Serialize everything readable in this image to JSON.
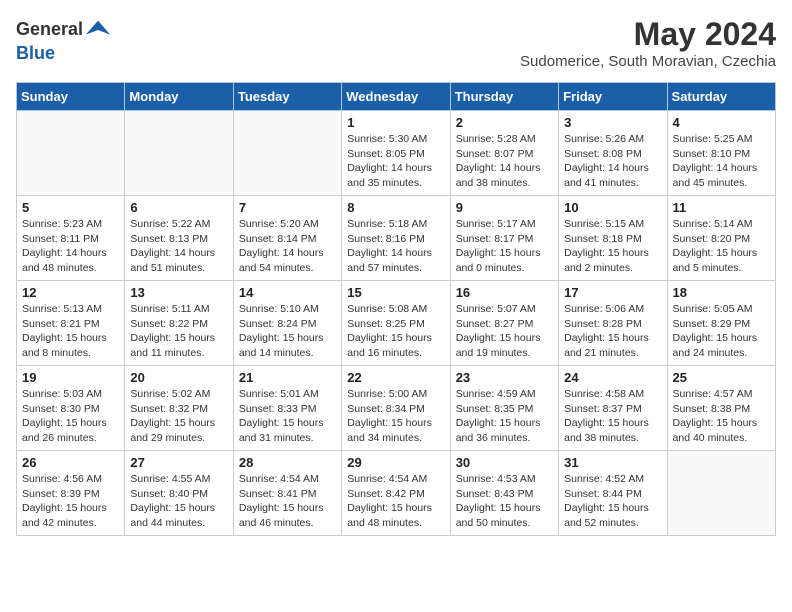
{
  "header": {
    "logo_line1": "General",
    "logo_line2": "Blue",
    "month_year": "May 2024",
    "location": "Sudomerice, South Moravian, Czechia"
  },
  "weekdays": [
    "Sunday",
    "Monday",
    "Tuesday",
    "Wednesday",
    "Thursday",
    "Friday",
    "Saturday"
  ],
  "weeks": [
    [
      {
        "day": "",
        "info": ""
      },
      {
        "day": "",
        "info": ""
      },
      {
        "day": "",
        "info": ""
      },
      {
        "day": "1",
        "info": "Sunrise: 5:30 AM\nSunset: 8:05 PM\nDaylight: 14 hours and 35 minutes."
      },
      {
        "day": "2",
        "info": "Sunrise: 5:28 AM\nSunset: 8:07 PM\nDaylight: 14 hours and 38 minutes."
      },
      {
        "day": "3",
        "info": "Sunrise: 5:26 AM\nSunset: 8:08 PM\nDaylight: 14 hours and 41 minutes."
      },
      {
        "day": "4",
        "info": "Sunrise: 5:25 AM\nSunset: 8:10 PM\nDaylight: 14 hours and 45 minutes."
      }
    ],
    [
      {
        "day": "5",
        "info": "Sunrise: 5:23 AM\nSunset: 8:11 PM\nDaylight: 14 hours and 48 minutes."
      },
      {
        "day": "6",
        "info": "Sunrise: 5:22 AM\nSunset: 8:13 PM\nDaylight: 14 hours and 51 minutes."
      },
      {
        "day": "7",
        "info": "Sunrise: 5:20 AM\nSunset: 8:14 PM\nDaylight: 14 hours and 54 minutes."
      },
      {
        "day": "8",
        "info": "Sunrise: 5:18 AM\nSunset: 8:16 PM\nDaylight: 14 hours and 57 minutes."
      },
      {
        "day": "9",
        "info": "Sunrise: 5:17 AM\nSunset: 8:17 PM\nDaylight: 15 hours and 0 minutes."
      },
      {
        "day": "10",
        "info": "Sunrise: 5:15 AM\nSunset: 8:18 PM\nDaylight: 15 hours and 2 minutes."
      },
      {
        "day": "11",
        "info": "Sunrise: 5:14 AM\nSunset: 8:20 PM\nDaylight: 15 hours and 5 minutes."
      }
    ],
    [
      {
        "day": "12",
        "info": "Sunrise: 5:13 AM\nSunset: 8:21 PM\nDaylight: 15 hours and 8 minutes."
      },
      {
        "day": "13",
        "info": "Sunrise: 5:11 AM\nSunset: 8:22 PM\nDaylight: 15 hours and 11 minutes."
      },
      {
        "day": "14",
        "info": "Sunrise: 5:10 AM\nSunset: 8:24 PM\nDaylight: 15 hours and 14 minutes."
      },
      {
        "day": "15",
        "info": "Sunrise: 5:08 AM\nSunset: 8:25 PM\nDaylight: 15 hours and 16 minutes."
      },
      {
        "day": "16",
        "info": "Sunrise: 5:07 AM\nSunset: 8:27 PM\nDaylight: 15 hours and 19 minutes."
      },
      {
        "day": "17",
        "info": "Sunrise: 5:06 AM\nSunset: 8:28 PM\nDaylight: 15 hours and 21 minutes."
      },
      {
        "day": "18",
        "info": "Sunrise: 5:05 AM\nSunset: 8:29 PM\nDaylight: 15 hours and 24 minutes."
      }
    ],
    [
      {
        "day": "19",
        "info": "Sunrise: 5:03 AM\nSunset: 8:30 PM\nDaylight: 15 hours and 26 minutes."
      },
      {
        "day": "20",
        "info": "Sunrise: 5:02 AM\nSunset: 8:32 PM\nDaylight: 15 hours and 29 minutes."
      },
      {
        "day": "21",
        "info": "Sunrise: 5:01 AM\nSunset: 8:33 PM\nDaylight: 15 hours and 31 minutes."
      },
      {
        "day": "22",
        "info": "Sunrise: 5:00 AM\nSunset: 8:34 PM\nDaylight: 15 hours and 34 minutes."
      },
      {
        "day": "23",
        "info": "Sunrise: 4:59 AM\nSunset: 8:35 PM\nDaylight: 15 hours and 36 minutes."
      },
      {
        "day": "24",
        "info": "Sunrise: 4:58 AM\nSunset: 8:37 PM\nDaylight: 15 hours and 38 minutes."
      },
      {
        "day": "25",
        "info": "Sunrise: 4:57 AM\nSunset: 8:38 PM\nDaylight: 15 hours and 40 minutes."
      }
    ],
    [
      {
        "day": "26",
        "info": "Sunrise: 4:56 AM\nSunset: 8:39 PM\nDaylight: 15 hours and 42 minutes."
      },
      {
        "day": "27",
        "info": "Sunrise: 4:55 AM\nSunset: 8:40 PM\nDaylight: 15 hours and 44 minutes."
      },
      {
        "day": "28",
        "info": "Sunrise: 4:54 AM\nSunset: 8:41 PM\nDaylight: 15 hours and 46 minutes."
      },
      {
        "day": "29",
        "info": "Sunrise: 4:54 AM\nSunset: 8:42 PM\nDaylight: 15 hours and 48 minutes."
      },
      {
        "day": "30",
        "info": "Sunrise: 4:53 AM\nSunset: 8:43 PM\nDaylight: 15 hours and 50 minutes."
      },
      {
        "day": "31",
        "info": "Sunrise: 4:52 AM\nSunset: 8:44 PM\nDaylight: 15 hours and 52 minutes."
      },
      {
        "day": "",
        "info": ""
      }
    ]
  ]
}
